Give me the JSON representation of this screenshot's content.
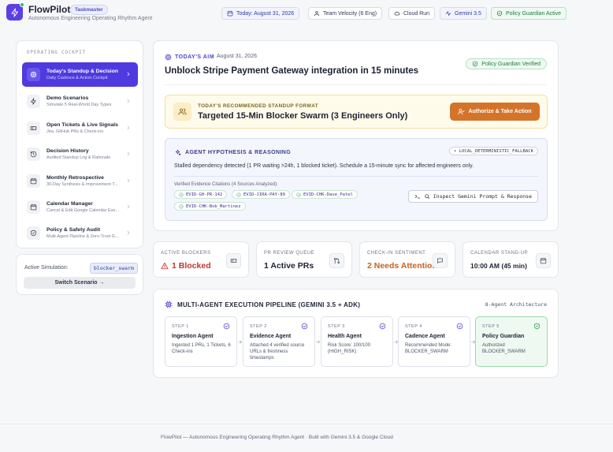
{
  "header": {
    "app_name": "FlowPilot",
    "tag": "Taskmaster",
    "subtitle": "Autonomous Engineering Operating Rhythm Agent",
    "pills": {
      "date": "Today: August 31, 2026",
      "team": "Team Velocity (6 Eng)",
      "run": "Cloud Run",
      "model": "Gemini 3.5",
      "guardian": "Policy Guardian Active"
    }
  },
  "sidebar": {
    "section_label": "OPERATING COCKPIT",
    "items": [
      {
        "title": "Today's Standup & Decision",
        "subtitle": "Daily Cadence & Action Cockpit",
        "icon": "target-icon"
      },
      {
        "title": "Demo Scenarios",
        "subtitle": "Simulate 5 Real-World Day Types",
        "icon": "bolt-icon"
      },
      {
        "title": "Open Tickets & Live Signals",
        "subtitle": "Jira, GitHub PRs & Check-ins",
        "icon": "ticket-icon"
      },
      {
        "title": "Decision History",
        "subtitle": "Audited Standup Log & Rationale",
        "icon": "history-icon"
      },
      {
        "title": "Monthly Retrospective",
        "subtitle": "30-Day Synthesis & Improvement T...",
        "icon": "calendar-icon"
      },
      {
        "title": "Calendar Manager",
        "subtitle": "Cancel & Edit Google Calendar Eve...",
        "icon": "calendar-icon"
      },
      {
        "title": "Policy & Safety Audit",
        "subtitle": "Multi-Agent Pipeline & Zero-Trust G...",
        "icon": "shield-icon"
      }
    ],
    "simulation": {
      "label": "Active Simulation:",
      "value": "blocker_swarm",
      "button": "Switch Scenario →"
    }
  },
  "aim": {
    "label": "TODAY'S AIM",
    "date": "August 31, 2026",
    "badge": "Policy Guardian Verified",
    "title": "Unblock Stripe Payment Gateway integration in 15 minutes",
    "format": {
      "label": "TODAY'S RECOMMENDED STANDUP FORMAT",
      "title": "Targeted 15-Min Blocker Swarm (3 Engineers Only)",
      "button": "Authorize & Take Action"
    },
    "hypothesis": {
      "label": "AGENT HYPOTHESIS & REASONING",
      "fallback": "• LOCAL_DETERMINISTIC_FALLBACK",
      "text": "Stalled dependency detected (1 PR waiting >24h, 1 blocked ticket). Schedule a 15-minute sync for affected engineers only.",
      "citations_label": "Verified Evidence Citations (4 Sources Analyzed):",
      "citations": [
        "EVID-GH-PR-142",
        "EVID-JIRA-PAY-89",
        "EVID-CHK-Dave_Patel",
        "EVID-CHK-Bob_Martinez"
      ],
      "inspect_button": "Inspect Gemini Prompt & Response"
    }
  },
  "stats": [
    {
      "label": "ACTIVE BLOCKERS",
      "value": "1 Blocked",
      "tone": "red"
    },
    {
      "label": "PR REVIEW QUEUE",
      "value": "1 Active PRs",
      "tone": "default"
    },
    {
      "label": "CHECK-IN SENTIMENT",
      "value": "2 Needs Attention",
      "tone": "orange"
    },
    {
      "label": "CALENDAR STAND-UP",
      "value": "10:00 AM (45 min)",
      "tone": "default"
    }
  ],
  "pipeline": {
    "title": "MULTI-AGENT EXECUTION PIPELINE (GEMINI 3.5 + ADK)",
    "architecture": "8-Agent Architecture",
    "steps": [
      {
        "step": "STEP 1",
        "name": "Ingestion Agent",
        "desc": "Ingested 1 PRs, 1 Tickets, 6 Check-ins"
      },
      {
        "step": "STEP 2",
        "name": "Evidence Agent",
        "desc": "Attached 4 verified source URLs & freshness timestamps"
      },
      {
        "step": "STEP 3",
        "name": "Health Agent",
        "desc": "Risk Score: 100/100 (HIGH_RISK)"
      },
      {
        "step": "STEP 4",
        "name": "Cadence Agent",
        "desc": "Recommended Mode: BLOCKER_SWARM"
      },
      {
        "step": "STEP 5",
        "name": "Policy Guardian",
        "desc": "Authorized BLOCKER_SWARM"
      }
    ]
  },
  "footer": {
    "text": "FlowPilot — Autonomous Engineering Operating Rhythm Agent · Built with Gemini 3.5 & Google Cloud"
  },
  "colors": {
    "brand": "#5b3fe4",
    "action": "#d4742b",
    "success": "#2d9a4f",
    "danger": "#c6332d"
  }
}
